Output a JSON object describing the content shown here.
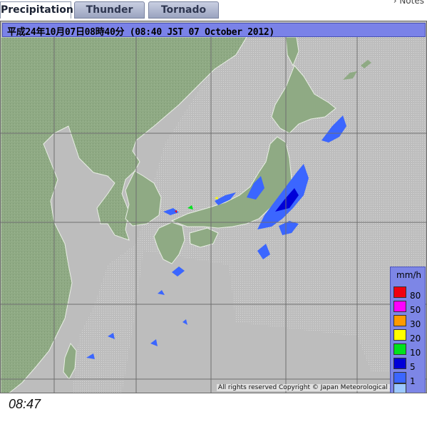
{
  "tabs": [
    {
      "label": "Precipitation",
      "active": true
    },
    {
      "label": "Thunder",
      "active": false
    },
    {
      "label": "Tornado",
      "active": false
    }
  ],
  "notes_link": "› Notes",
  "map": {
    "title": "平成24年10月07日08時40分  (08:40 JST 07 October 2012)",
    "credit": "All rights reserved  Copyright © Japan Meteorological Agency",
    "colors": {
      "sea": "#bdbdbd",
      "land": "#8faa84",
      "grid": "#6f6f6f",
      "title_bar": "#7a82e8"
    }
  },
  "legend": {
    "unit": "mm/h",
    "items": [
      {
        "label": "80",
        "color": "#f00010"
      },
      {
        "label": "50",
        "color": "#ff00ff"
      },
      {
        "label": "30",
        "color": "#ff9a00"
      },
      {
        "label": "20",
        "color": "#ffff00"
      },
      {
        "label": "10",
        "color": "#00e21e"
      },
      {
        "label": "5",
        "color": "#0000d8"
      },
      {
        "label": "1",
        "color": "#3b66ff"
      },
      {
        "label": "",
        "color": "#9cc8ff"
      }
    ]
  },
  "timestamp": "08:47"
}
